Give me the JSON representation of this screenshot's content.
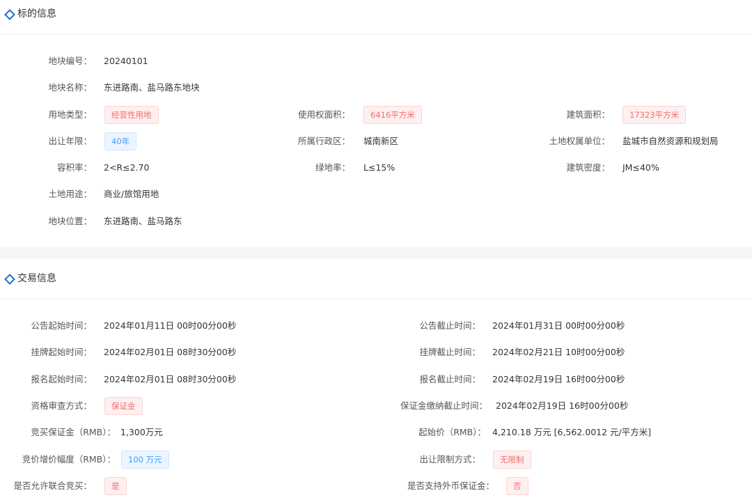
{
  "section1": {
    "title": "标的信息",
    "plot_no_label": "地块编号：",
    "plot_no": "20240101",
    "plot_name_label": "地块名称：",
    "plot_name": "东进路南、盐马路东地块",
    "land_type_label": "用地类型：",
    "land_type": "经营性用地",
    "use_area_label": "使用权面积：",
    "use_area": "6416平方米",
    "build_area_label": "建筑面积：",
    "build_area": "17323平方米",
    "term_label": "出让年限：",
    "term": "40年",
    "district_label": "所属行政区：",
    "district": "城南新区",
    "owner_label": "土地权属单位：",
    "owner": "盐城市自然资源和规划局",
    "far_label": "容积率：",
    "far": "2<R≤2.70",
    "green_label": "绿地率：",
    "green": "L≤15%",
    "density_label": "建筑密度：",
    "density": "JM≤40%",
    "usage_label": "土地用途：",
    "usage": "商业/旅馆用地",
    "location_label": "地块位置：",
    "location": "东进路南、盐马路东"
  },
  "section2": {
    "title": "交易信息",
    "notice_start_label": "公告起始时间：",
    "notice_start": "2024年01月11日 00时00分00秒",
    "notice_end_label": "公告截止时间：",
    "notice_end": "2024年01月31日 00时00分00秒",
    "list_start_label": "挂牌起始时间：",
    "list_start": "2024年02月01日 08时30分00秒",
    "list_end_label": "挂牌截止时间：",
    "list_end": "2024年02月21日 10时00分00秒",
    "reg_start_label": "报名起始时间：",
    "reg_start": "2024年02月01日 08时30分00秒",
    "reg_end_label": "报名截止时间：",
    "reg_end": "2024年02月19日 16时00分00秒",
    "review_label": "资格审查方式：",
    "review": "保证金",
    "deposit_deadline_label": "保证金缴纳截止时间：",
    "deposit_deadline": "2024年02月19日 16时00分00秒",
    "deposit_label": "竞买保证金（RMB）：",
    "deposit": "1,300万元",
    "start_price_label": "起始价（RMB）：",
    "start_price": "4,210.18 万元 [6,562.0012 元/平方米]",
    "increment_label": "竞价增价幅度（RMB）：",
    "increment": "100 万元",
    "restriction_label": "出让限制方式：",
    "restriction": "无限制",
    "joint_label": "是否允许联合竞买：",
    "joint": "是",
    "foreign_label": "是否支持外币保证金：",
    "foreign": "否"
  },
  "colors": {
    "accent": "#1f6fd1",
    "tag_red": "#f56c6c",
    "tag_blue": "#409eff"
  },
  "icons": {
    "section_marker": "diamond-icon"
  }
}
